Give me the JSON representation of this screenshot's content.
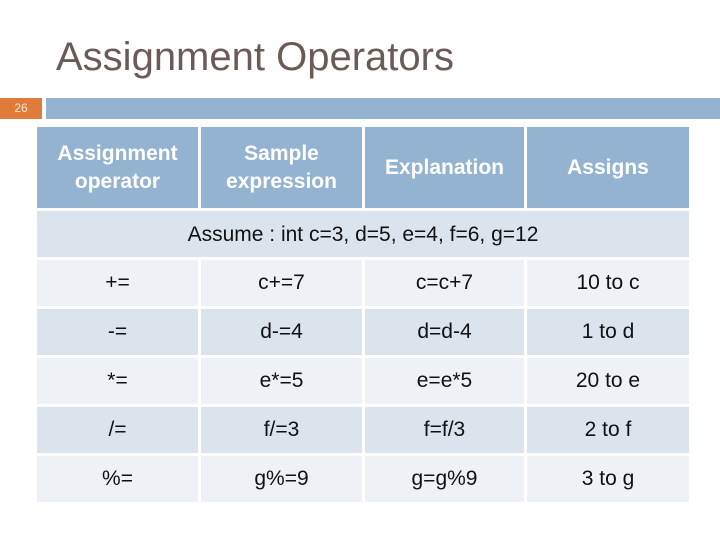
{
  "slide": {
    "title": "Assignment Operators",
    "number": "26"
  },
  "colors": {
    "header_bg": "#94b3d1",
    "slide_number_bg": "#e07b39",
    "title_text": "#6b5b57",
    "row_light": "#eef1f5",
    "row_dark": "#dbe3ec"
  },
  "table": {
    "headers": [
      "Assignment operator",
      "Sample expression",
      "Explanation",
      "Assigns"
    ],
    "assumption": "Assume : int c=3, d=5, e=4, f=6, g=12",
    "rows": [
      [
        "+=",
        "c+=7",
        "c=c+7",
        "10 to c"
      ],
      [
        "-=",
        "d-=4",
        "d=d-4",
        "1 to d"
      ],
      [
        "*=",
        "e*=5",
        "e=e*5",
        "20 to e"
      ],
      [
        "/=",
        "f/=3",
        "f=f/3",
        "2 to f"
      ],
      [
        "%=",
        "g%=9",
        "g=g%9",
        "3 to g"
      ]
    ]
  }
}
